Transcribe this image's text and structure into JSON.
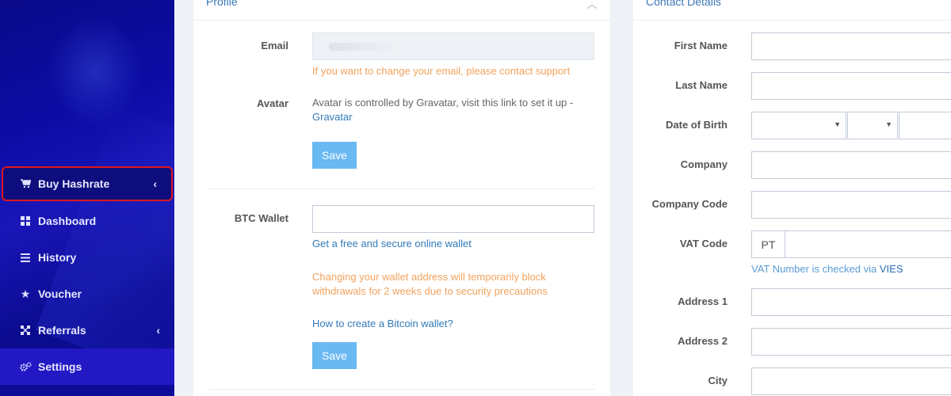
{
  "sidebar": {
    "items": [
      {
        "label": "Buy Hashrate",
        "icon": "cart-icon"
      },
      {
        "label": "Dashboard",
        "icon": "grid-icon"
      },
      {
        "label": "History",
        "icon": "list-icon"
      },
      {
        "label": "Voucher",
        "icon": "star-icon"
      },
      {
        "label": "Referrals",
        "icon": "network-icon"
      },
      {
        "label": "Settings",
        "icon": "gears-icon"
      }
    ]
  },
  "profile": {
    "title": "Profile",
    "email_label": "Email",
    "email_help": "If you want to change your email, please contact support",
    "avatar_label": "Avatar",
    "avatar_text": "Avatar is controlled by Gravatar, visit this link to set it up -",
    "avatar_link": "Gravatar",
    "save_label": "Save",
    "btc_label": "BTC Wallet",
    "btc_link": "Get a free and secure online wallet",
    "btc_warning_1": "Changing your wallet address will temporarily block",
    "btc_warning_2": "withdrawals for 2 weeks due to security precautions",
    "btc_howto": "How to create a Bitcoin wallet?",
    "save2_label": "Save"
  },
  "contact": {
    "title": "Contact Details",
    "first_name": "First Name",
    "last_name": "Last Name",
    "dob": "Date of Birth",
    "company": "Company",
    "company_code": "Company Code",
    "vat_code": "VAT Code",
    "vat_prefix": "PT",
    "vat_help": "VAT Number is checked via",
    "vat_link": "VIES",
    "address1": "Address 1",
    "address2": "Address 2",
    "city": "City"
  }
}
